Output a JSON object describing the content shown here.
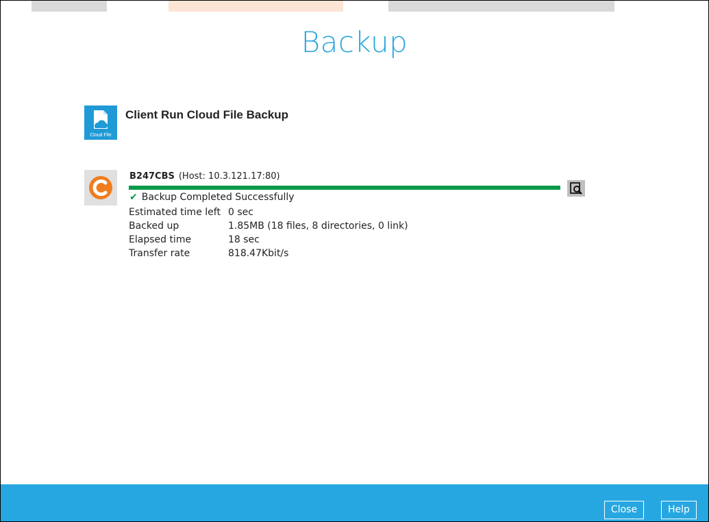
{
  "page": {
    "title": "Backup"
  },
  "backup_set": {
    "name": "Client Run Cloud File Backup",
    "icon": "cloud-file-icon",
    "icon_caption": "Cloud File"
  },
  "destination": {
    "name": "B247CBS",
    "host": "(Host: 10.3.121.17:80)",
    "icon": "cbs-logo-icon",
    "progress_percent": 100,
    "status_text": "Backup Completed Successfully",
    "stats": [
      {
        "label": "Estimated time left",
        "value": "0 sec"
      },
      {
        "label": "Backed up",
        "value": "1.85MB (18 files, 8 directories, 0 link)"
      },
      {
        "label": "Elapsed time",
        "value": "18 sec"
      },
      {
        "label": "Transfer rate",
        "value": "818.47Kbit/s"
      }
    ]
  },
  "footer": {
    "close_label": "Close",
    "help_label": "Help"
  },
  "colors": {
    "title": "#2aa6dc",
    "progress": "#0a9a4a",
    "footer": "#27a7e1",
    "brand_orange": "#f07c1e"
  }
}
